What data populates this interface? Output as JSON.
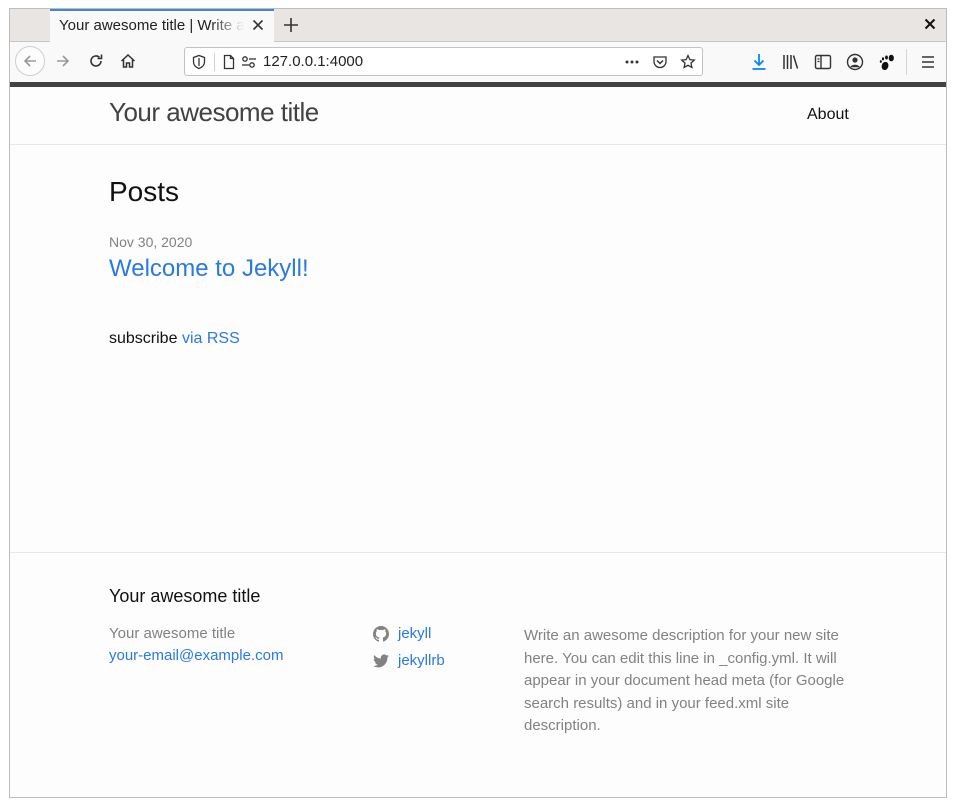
{
  "browser": {
    "tab_title": "Your awesome title | Write an awesome description for your new site here.",
    "url": "127.0.0.1:4000"
  },
  "site": {
    "title": "Your awesome title",
    "nav": {
      "about_label": "About"
    }
  },
  "main": {
    "heading": "Posts",
    "posts": [
      {
        "date": "Nov 30, 2020",
        "title": "Welcome to Jekyll!"
      }
    ],
    "rss_prefix": "subscribe",
    "rss_link": "via RSS"
  },
  "footer": {
    "heading": "Your awesome title",
    "name": "Your awesome title",
    "email": "your-email@example.com",
    "social": [
      {
        "icon": "github-icon",
        "label": "jekyll"
      },
      {
        "icon": "twitter-icon",
        "label": "jekyllrb"
      }
    ],
    "description": "Write an awesome description for your new site here. You can edit this line in _config.yml. It will appear in your document head meta (for Google search results) and in your feed.xml site description."
  },
  "colors": {
    "link": "#2a7ae2",
    "muted": "#828282",
    "top_border": "#424242",
    "download_icon": "#0a84ff"
  }
}
